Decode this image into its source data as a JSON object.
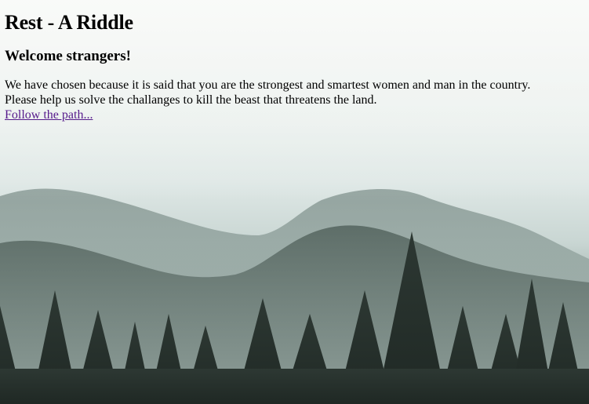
{
  "page": {
    "title": "Rest - A Riddle",
    "subtitle": "Welcome strangers!",
    "intro_line1": "We have chosen because it is said that you are the strongest and smartest women and man in the country.",
    "intro_line2": "Please help us solve the challanges to kill the beast that threatens the land.",
    "link_text": "Follow the path..."
  },
  "colors": {
    "link_visited": "#551a8b",
    "text": "#000000"
  },
  "background": {
    "description_icon": "misty-forest-icon"
  }
}
